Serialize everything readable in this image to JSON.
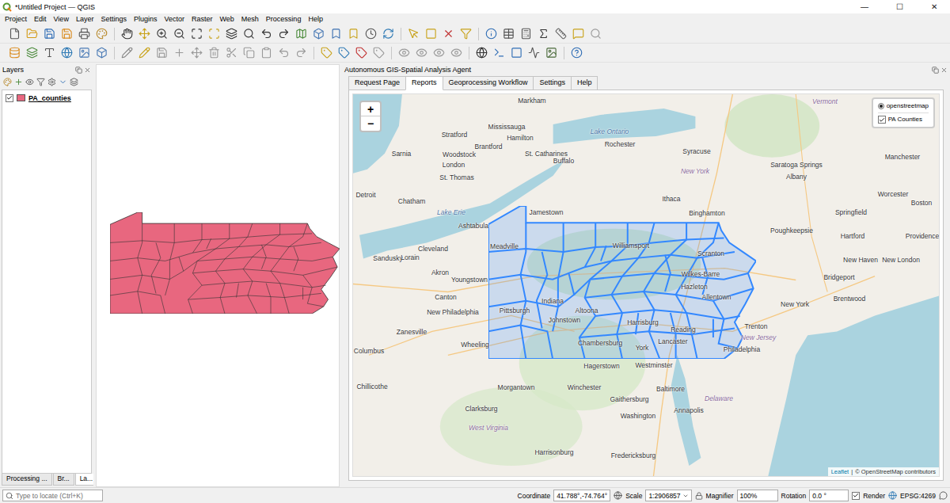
{
  "window": {
    "title": "*Untitled Project — QGIS",
    "controls": [
      "—",
      "☐",
      "✕"
    ]
  },
  "menu": [
    "Project",
    "Edit",
    "View",
    "Layer",
    "Settings",
    "Plugins",
    "Vector",
    "Raster",
    "Web",
    "Mesh",
    "Processing",
    "Help"
  ],
  "layers_panel": {
    "title": "Layers",
    "layers": [
      {
        "name": "PA_counties",
        "checked": true
      }
    ],
    "bottom_tabs": [
      {
        "label": "Processing ...",
        "selected": false
      },
      {
        "label": "Br...",
        "selected": false
      },
      {
        "label": "La...",
        "selected": true
      }
    ]
  },
  "agent_panel": {
    "title": "Autonomous GIS-Spatial Analysis Agent",
    "tabs": [
      {
        "label": "Request Page",
        "selected": false
      },
      {
        "label": "Reports",
        "selected": true
      },
      {
        "label": "Geoprocessing Workflow",
        "selected": false
      },
      {
        "label": "Settings",
        "selected": false
      },
      {
        "label": "Help",
        "selected": false
      }
    ]
  },
  "web_map": {
    "zoom_in": "+",
    "zoom_out": "−",
    "base_layers": [
      {
        "label": "openstreetmap",
        "selected": true
      }
    ],
    "overlays": [
      {
        "label": "PA Counties",
        "checked": true
      }
    ],
    "attribution": [
      "Leaflet",
      "|",
      "© OpenStreetMap contributors"
    ],
    "labels": [
      {
        "text": "Markham",
        "kind": "city"
      },
      {
        "text": "Mississauga",
        "kind": "city"
      },
      {
        "text": "Hamilton",
        "kind": "city"
      },
      {
        "text": "Stratford",
        "kind": "city"
      },
      {
        "text": "Brantford",
        "kind": "city"
      },
      {
        "text": "Woodstock",
        "kind": "city"
      },
      {
        "text": "St. Catharines",
        "kind": "city"
      },
      {
        "text": "Lake Ontario",
        "kind": "water"
      },
      {
        "text": "Rochester",
        "kind": "city"
      },
      {
        "text": "Syracuse",
        "kind": "city"
      },
      {
        "text": "Saratoga Springs",
        "kind": "city"
      },
      {
        "text": "Albany",
        "kind": "city"
      },
      {
        "text": "Manchester",
        "kind": "city"
      },
      {
        "text": "Vermont",
        "kind": "region"
      },
      {
        "text": "Sarnia",
        "kind": "city"
      },
      {
        "text": "London",
        "kind": "city"
      },
      {
        "text": "St. Thomas",
        "kind": "city"
      },
      {
        "text": "Buffalo",
        "kind": "city"
      },
      {
        "text": "New York",
        "kind": "region"
      },
      {
        "text": "Boston",
        "kind": "city"
      },
      {
        "text": "Worcester",
        "kind": "city"
      },
      {
        "text": "Detroit",
        "kind": "city"
      },
      {
        "text": "Chatham",
        "kind": "city"
      },
      {
        "text": "Lake Erie",
        "kind": "water"
      },
      {
        "text": "Jamestown",
        "kind": "city"
      },
      {
        "text": "Ithaca",
        "kind": "city"
      },
      {
        "text": "Binghamton",
        "kind": "city"
      },
      {
        "text": "Springfield",
        "kind": "city"
      },
      {
        "text": "Hartford",
        "kind": "city"
      },
      {
        "text": "Providence",
        "kind": "city"
      },
      {
        "text": "Poughkeepsie",
        "kind": "city"
      },
      {
        "text": "Sandusky",
        "kind": "city"
      },
      {
        "text": "Lorain",
        "kind": "city"
      },
      {
        "text": "Cleveland",
        "kind": "city"
      },
      {
        "text": "Ashtabula",
        "kind": "city"
      },
      {
        "text": "Meadville",
        "kind": "city"
      },
      {
        "text": "Akron",
        "kind": "city"
      },
      {
        "text": "Youngstown",
        "kind": "city"
      },
      {
        "text": "Canton",
        "kind": "city"
      },
      {
        "text": "Williamsport",
        "kind": "city"
      },
      {
        "text": "Scranton",
        "kind": "city"
      },
      {
        "text": "Wilkes-Barre",
        "kind": "city"
      },
      {
        "text": "New Haven",
        "kind": "city"
      },
      {
        "text": "Bridgeport",
        "kind": "city"
      },
      {
        "text": "New London",
        "kind": "city"
      },
      {
        "text": "Brentwood",
        "kind": "city"
      },
      {
        "text": "New York",
        "kind": "city"
      },
      {
        "text": "Pittsburgh",
        "kind": "city"
      },
      {
        "text": "Indiana",
        "kind": "city"
      },
      {
        "text": "Johnstown",
        "kind": "city"
      },
      {
        "text": "Altoona",
        "kind": "city"
      },
      {
        "text": "Hazleton",
        "kind": "city"
      },
      {
        "text": "Allentown",
        "kind": "city"
      },
      {
        "text": "Harrisburg",
        "kind": "city"
      },
      {
        "text": "Reading",
        "kind": "city"
      },
      {
        "text": "Lancaster",
        "kind": "city"
      },
      {
        "text": "York",
        "kind": "city"
      },
      {
        "text": "Chambersburg",
        "kind": "city"
      },
      {
        "text": "Philadelphia",
        "kind": "city"
      },
      {
        "text": "Trenton",
        "kind": "city"
      },
      {
        "text": "New Jersey",
        "kind": "region"
      },
      {
        "text": "Columbus",
        "kind": "city"
      },
      {
        "text": "Zanesville",
        "kind": "city"
      },
      {
        "text": "New Philadelphia",
        "kind": "city"
      },
      {
        "text": "Wheeling",
        "kind": "city"
      },
      {
        "text": "Chillicothe",
        "kind": "city"
      },
      {
        "text": "Morgantown",
        "kind": "city"
      },
      {
        "text": "Clarksburg",
        "kind": "city"
      },
      {
        "text": "Hagerstown",
        "kind": "city"
      },
      {
        "text": "Westminster",
        "kind": "city"
      },
      {
        "text": "Baltimore",
        "kind": "city"
      },
      {
        "text": "Winchester",
        "kind": "city"
      },
      {
        "text": "Gaithersburg",
        "kind": "city"
      },
      {
        "text": "Delaware",
        "kind": "region"
      },
      {
        "text": "Washington",
        "kind": "city"
      },
      {
        "text": "Annapolis",
        "kind": "city"
      },
      {
        "text": "West Virginia",
        "kind": "region"
      },
      {
        "text": "Harrisonburg",
        "kind": "city"
      },
      {
        "text": "Fredericksburg",
        "kind": "city"
      }
    ]
  },
  "status_bar": {
    "search_placeholder": "Type to locate (Ctrl+K)",
    "coordinate_label": "Coordinate",
    "coordinate": "41.788°,-74.764°",
    "scale_label": "Scale",
    "scale": "1:2906857",
    "magnifier_label": "Magnifier",
    "magnifier": "100%",
    "rotation_label": "Rotation",
    "rotation": "0.0 °",
    "render_label": "Render",
    "render": true,
    "crs": "EPSG:4269"
  }
}
